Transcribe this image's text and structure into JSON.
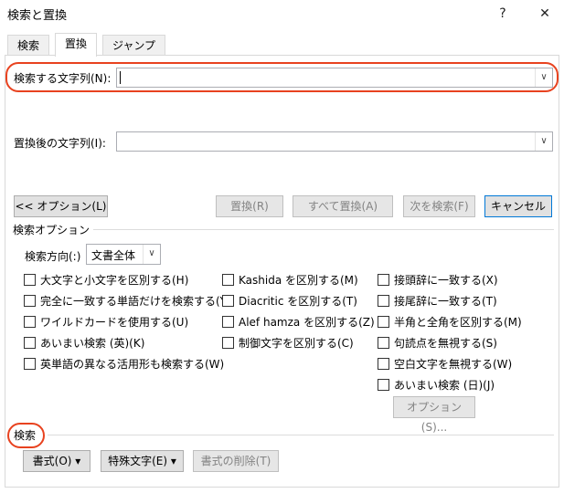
{
  "window": {
    "title": "検索と置換",
    "help_glyph": "?",
    "close_glyph": "✕"
  },
  "tabs": [
    {
      "label": "検索"
    },
    {
      "label": "置換"
    },
    {
      "label": "ジャンプ"
    }
  ],
  "find": {
    "label": "検索する文字列(N):",
    "value": ""
  },
  "replace": {
    "label": "置換後の文字列(I):",
    "value": ""
  },
  "buttons": {
    "options": "<< オプション(L)",
    "replace": "置換(R)",
    "replace_all": "すべて置換(A)",
    "find_next": "次を検索(F)",
    "cancel": "キャンセル"
  },
  "search_options": {
    "header": "検索オプション",
    "direction_label": "検索方向(:)",
    "direction_value": "文書全体",
    "col1": [
      "大文字と小文字を区別する(H)",
      "完全に一致する単語だけを検索する(Y)",
      "ワイルドカードを使用する(U)",
      "あいまい検索 (英)(K)",
      "英単語の異なる活用形も検索する(W)"
    ],
    "col2": [
      "Kashida を区別する(M)",
      "Diacritic を区別する(T)",
      "Alef hamza を区別する(Z)",
      "制御文字を区別する(C)"
    ],
    "col3": [
      "接頭辞に一致する(X)",
      "接尾辞に一致する(T)",
      "半角と全角を区別する(M)",
      "句読点を無視する(S)",
      "空白文字を無視する(W)",
      "あいまい検索 (日)(J)"
    ],
    "options_button": "オプション(S)..."
  },
  "bottom": {
    "header": "検索",
    "format": "書式(O)",
    "special": "特殊文字(E)",
    "no_format": "書式の削除(T)",
    "dropdown_glyph": "▾"
  },
  "colors": {
    "highlight": "#e8421f"
  }
}
